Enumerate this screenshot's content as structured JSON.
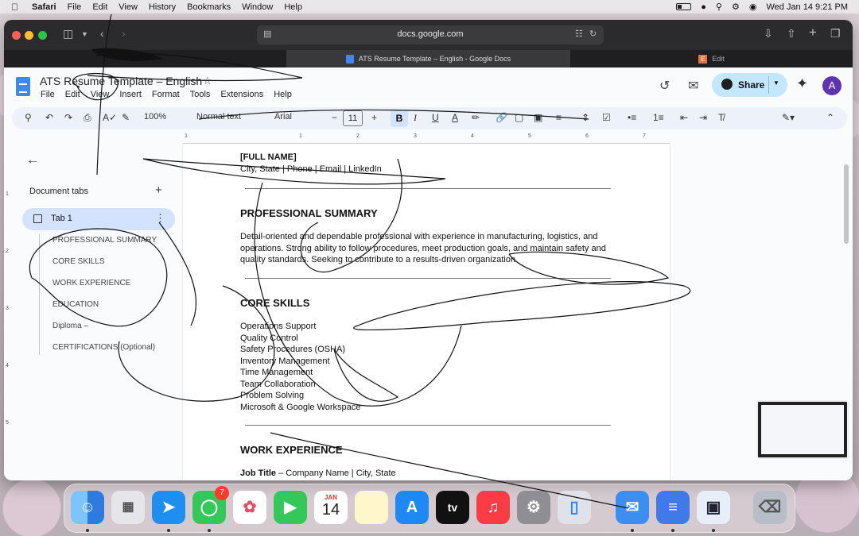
{
  "menubar": {
    "app": "Safari",
    "items": [
      "File",
      "Edit",
      "View",
      "History",
      "Bookmarks",
      "Window",
      "Help"
    ],
    "datetime": "Wed Jan 14  9:21 PM"
  },
  "browser": {
    "url": "docs.google.com",
    "tabs": [
      {
        "title": "ATS Resume Template – English - Google Docs",
        "active": true
      },
      {
        "title": "Edit",
        "active": false
      }
    ]
  },
  "docs": {
    "title": "ATS Resume Template – English",
    "menu": [
      "File",
      "Edit",
      "View",
      "Insert",
      "Format",
      "Tools",
      "Extensions",
      "Help"
    ],
    "share_label": "Share",
    "avatar_initial": "A",
    "toolbar": {
      "zoom": "100%",
      "style": "Normal text",
      "font": "Arial",
      "font_size": "11"
    },
    "ruler": [
      "1",
      "1",
      "2",
      "3",
      "4",
      "5",
      "6",
      "7"
    ],
    "vruler": [
      "1",
      "2",
      "3",
      "4",
      "5"
    ]
  },
  "sidebar": {
    "title": "Document tabs",
    "tab": "Tab 1",
    "outline": [
      "PROFESSIONAL SUMMARY",
      "CORE SKILLS",
      "WORK EXPERIENCE",
      "EDUCATION",
      "Diploma –",
      "CERTIFICATIONS (Optional)"
    ]
  },
  "document": {
    "name": "[FULL NAME]",
    "contact": "City, State | Phone | Email | LinkedIn",
    "summary_heading": "PROFESSIONAL SUMMARY",
    "summary_lines": [
      "Detail-oriented and dependable professional with experience in manufacturing, logistics, and",
      "operations. Strong ability to follow procedures, meet production goals, and maintain safety and",
      "quality standards. Seeking to contribute to a results-driven organization."
    ],
    "skills_heading": "CORE SKILLS",
    "skills": [
      "Operations Support",
      "Quality Control",
      "Safety Procedures (OSHA)",
      "Inventory Management",
      "Time Management",
      "Team Collaboration",
      "Problem Solving",
      "Microsoft & Google Workspace"
    ],
    "work_heading": "WORK EXPERIENCE",
    "job_title": "Job Title",
    "job_rest": " – Company Name | City, State"
  },
  "dock": {
    "calendar_month": "JAN",
    "calendar_day": "14",
    "messages_badge": "7",
    "tv_label": "tv"
  }
}
